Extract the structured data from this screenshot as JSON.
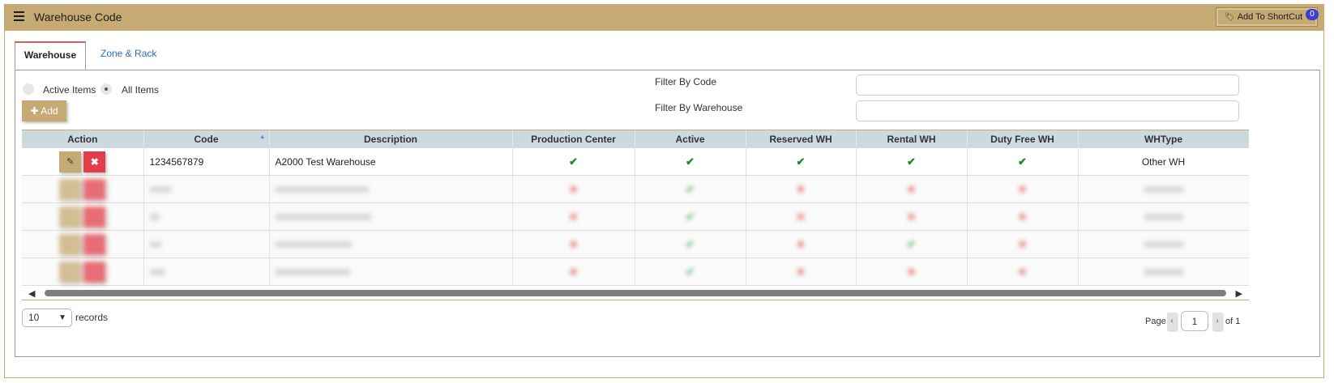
{
  "header": {
    "title": "Warehouse Code",
    "shortcut_label": "Add To ShortCut",
    "shortcut_badge": "0",
    "menu_icon": "hamburger-icon",
    "shortcut_icon": "tag-icon",
    "bar_color": "#c6aa73"
  },
  "tabs": [
    {
      "label": "Warehouse",
      "active": true
    },
    {
      "label": "Zone & Rack",
      "active": false
    }
  ],
  "filters": {
    "active_items_label": "Active Items",
    "all_items_label": "All Items",
    "selected": "All Items",
    "add_label": "Add",
    "code_label": "Filter By Code",
    "code_value": "",
    "warehouse_label": "Filter By Warehouse",
    "warehouse_value": ""
  },
  "table": {
    "columns": [
      "Action",
      "Code",
      "Description",
      "Production Center",
      "Active",
      "Reserved WH",
      "Rental WH",
      "Duty Free WH",
      "WHType"
    ],
    "sorted_column": "Code",
    "rows": [
      {
        "code": "1234567879",
        "description": "A2000 Test Warehouse",
        "production_center": true,
        "active": true,
        "reserved": true,
        "rental": true,
        "duty_free": true,
        "whtype": "Other WH",
        "blurred": false
      }
    ]
  },
  "pagination": {
    "page_size": "10",
    "records_label": "records",
    "page_label": "Page",
    "current_page": "1",
    "of_label": "of 1"
  },
  "colors": {
    "accent": "#c6aa73",
    "header_row": "#cdd9e1",
    "delete": "#e33d4a",
    "check": "#1b8a2a",
    "link": "#2c6fbf"
  }
}
